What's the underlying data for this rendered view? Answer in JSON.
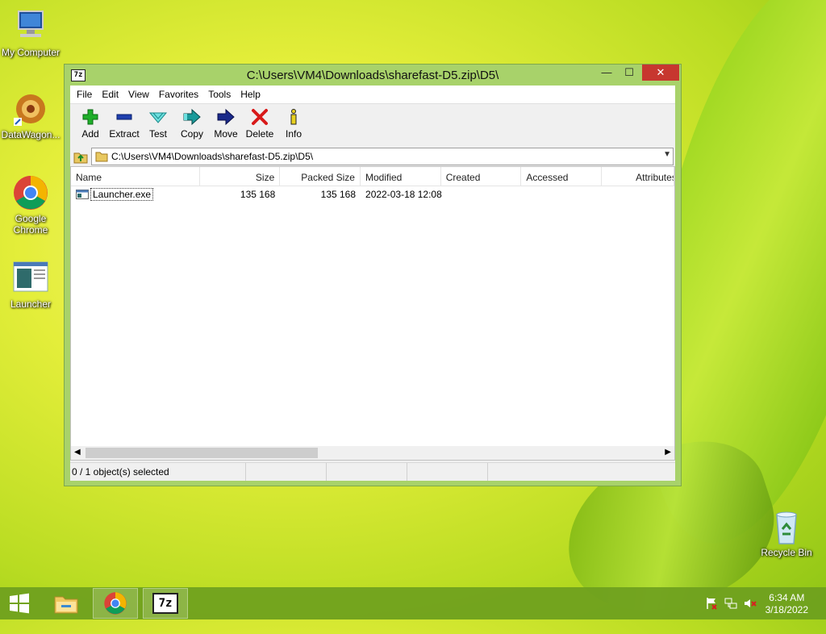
{
  "desktop": {
    "icons": [
      {
        "label": "My Computer",
        "icon": "computer-icon"
      },
      {
        "label": "DataWagon...",
        "icon": "datawagon-icon"
      },
      {
        "label": "Google Chrome",
        "icon": "chrome-icon"
      },
      {
        "label": "Launcher",
        "icon": "launcher-icon"
      },
      {
        "label": "Recycle Bin",
        "icon": "recycle-bin-icon"
      }
    ]
  },
  "window": {
    "app_icon": "7z",
    "title": "C:\\Users\\VM4\\Downloads\\sharefast-D5.zip\\D5\\",
    "controls": {
      "minimize": "—",
      "maximize": "☐",
      "close": "✕"
    }
  },
  "menu": [
    "File",
    "Edit",
    "View",
    "Favorites",
    "Tools",
    "Help"
  ],
  "toolbar": [
    {
      "label": "Add",
      "icon": "add-icon"
    },
    {
      "label": "Extract",
      "icon": "extract-icon"
    },
    {
      "label": "Test",
      "icon": "test-icon"
    },
    {
      "label": "Copy",
      "icon": "copy-icon"
    },
    {
      "label": "Move",
      "icon": "move-icon"
    },
    {
      "label": "Delete",
      "icon": "delete-icon"
    },
    {
      "label": "Info",
      "icon": "info-icon"
    }
  ],
  "address": {
    "path": "C:\\Users\\VM4\\Downloads\\sharefast-D5.zip\\D5\\"
  },
  "columns": [
    "Name",
    "Size",
    "Packed Size",
    "Modified",
    "Created",
    "Accessed",
    "Attributes"
  ],
  "files": [
    {
      "name": "Launcher.exe",
      "size": "135 168",
      "packed": "135 168",
      "modified": "2022-03-18 12:08",
      "created": "",
      "accessed": "",
      "attributes": ""
    }
  ],
  "status": {
    "selection": "0 / 1 object(s) selected"
  },
  "taskbar": {
    "time": "6:34 AM",
    "date": "3/18/2022"
  }
}
